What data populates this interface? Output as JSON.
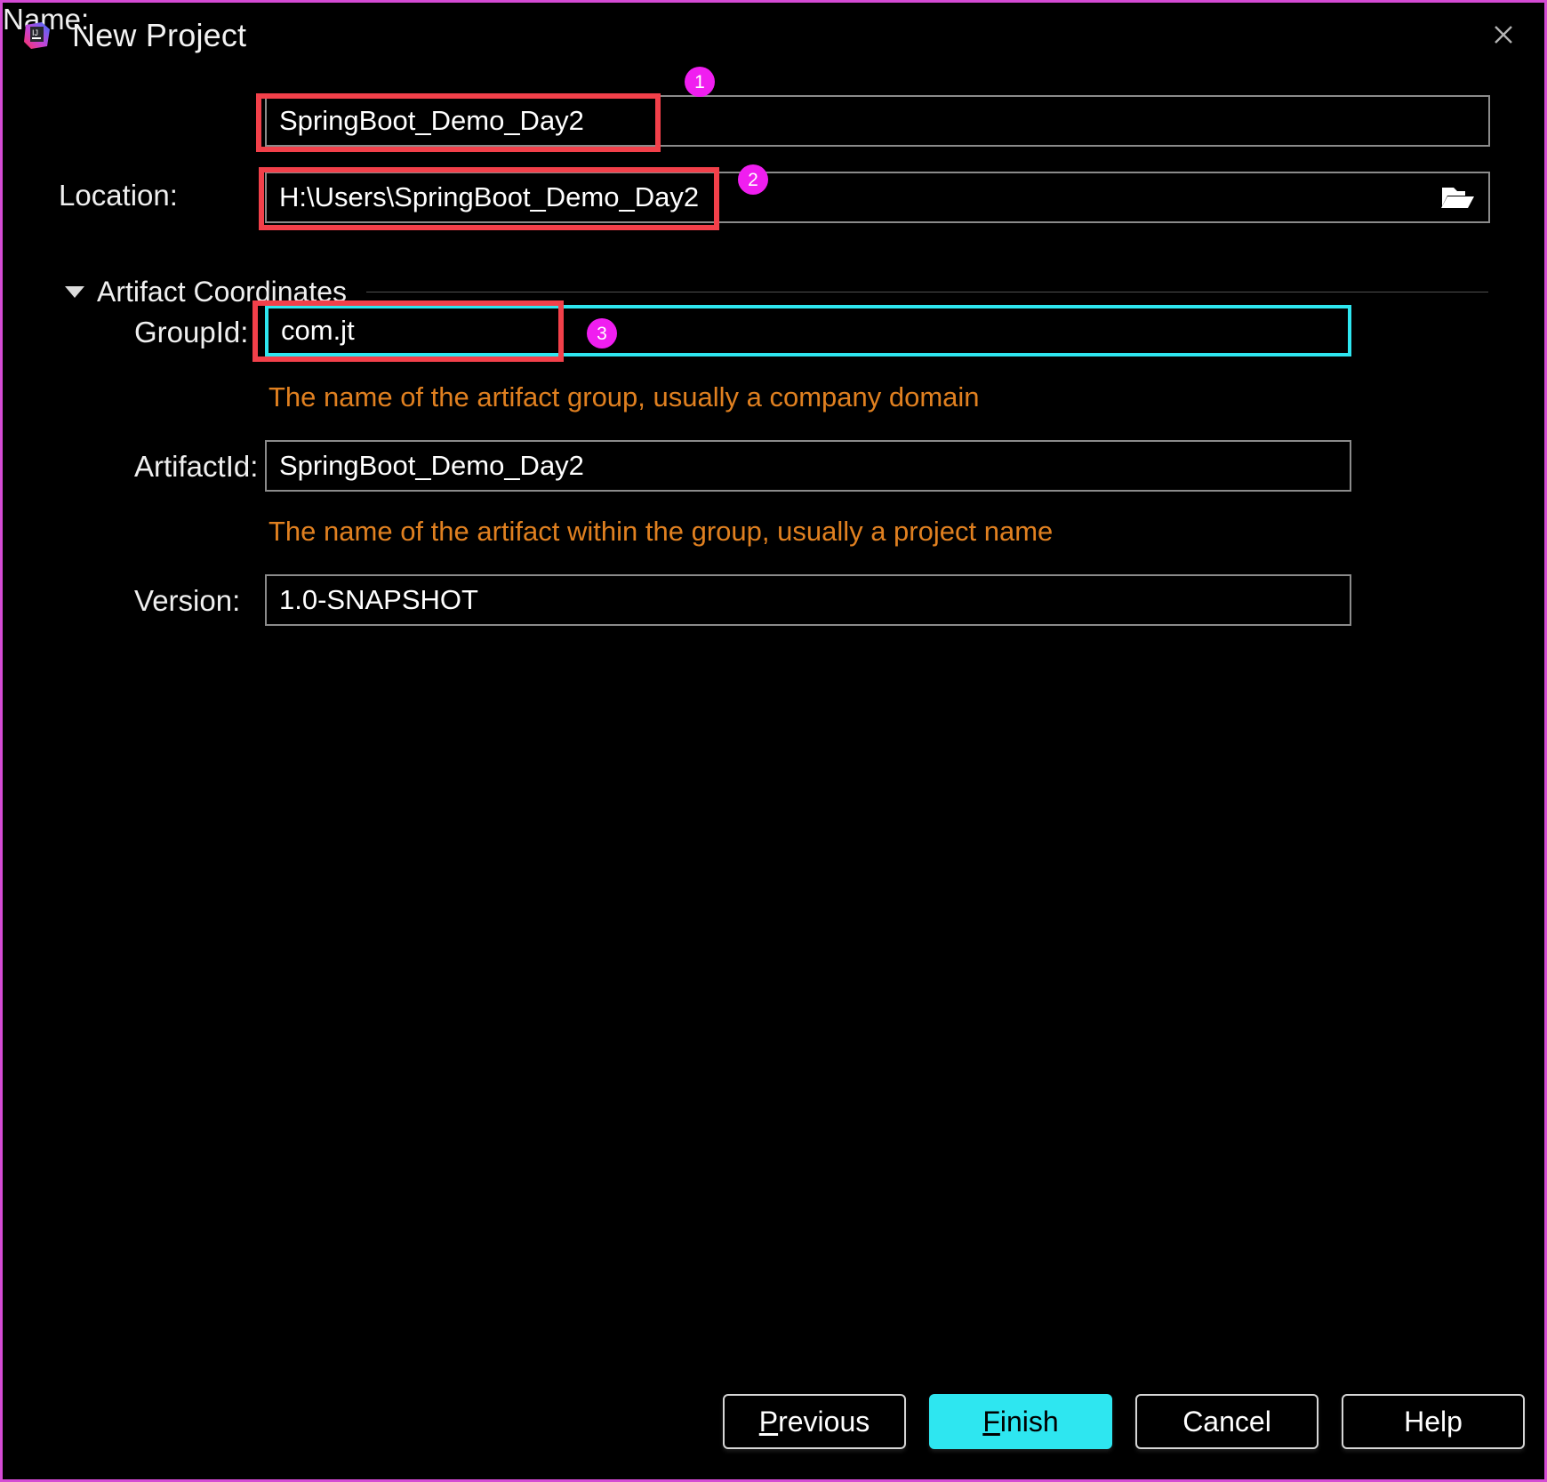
{
  "window": {
    "title": "New Project",
    "app_icon": "intellij-idea-icon",
    "close_icon": "close-icon",
    "frame_color": "#d44bd4"
  },
  "form": {
    "name": {
      "label": "Name:",
      "value": "SpringBoot_Demo_Day2"
    },
    "location": {
      "label": "Location:",
      "value": "H:\\Users\\SpringBoot_Demo_Day2",
      "browse_icon": "folder-open-icon"
    },
    "artifact_section": {
      "title": "Artifact Coordinates",
      "caret_icon": "chevron-down-icon",
      "expanded": true
    },
    "group_id": {
      "label": "GroupId:",
      "value": "com.jt",
      "hint": "The name of the artifact group, usually a company domain",
      "focused": true
    },
    "artifact_id": {
      "label": "ArtifactId:",
      "value": "SpringBoot_Demo_Day2",
      "hint": "The name of the artifact within the group, usually a project name"
    },
    "version": {
      "label": "Version:",
      "value": "1.0-SNAPSHOT"
    }
  },
  "annotations": {
    "highlight_color": "#f2404a",
    "badge_color": "#f01ef0",
    "badges": [
      {
        "number": "1",
        "target": "name-field"
      },
      {
        "number": "2",
        "target": "location-field"
      },
      {
        "number": "3",
        "target": "groupid-field"
      }
    ]
  },
  "footer": {
    "previous": {
      "label": "Previous",
      "mnemonic": "P",
      "rest": "revious"
    },
    "finish": {
      "label": "Finish",
      "mnemonic": "F",
      "rest": "inish",
      "primary": true,
      "accent": "#2ee6f0"
    },
    "cancel": {
      "label": "Cancel"
    },
    "help": {
      "label": "Help"
    }
  }
}
